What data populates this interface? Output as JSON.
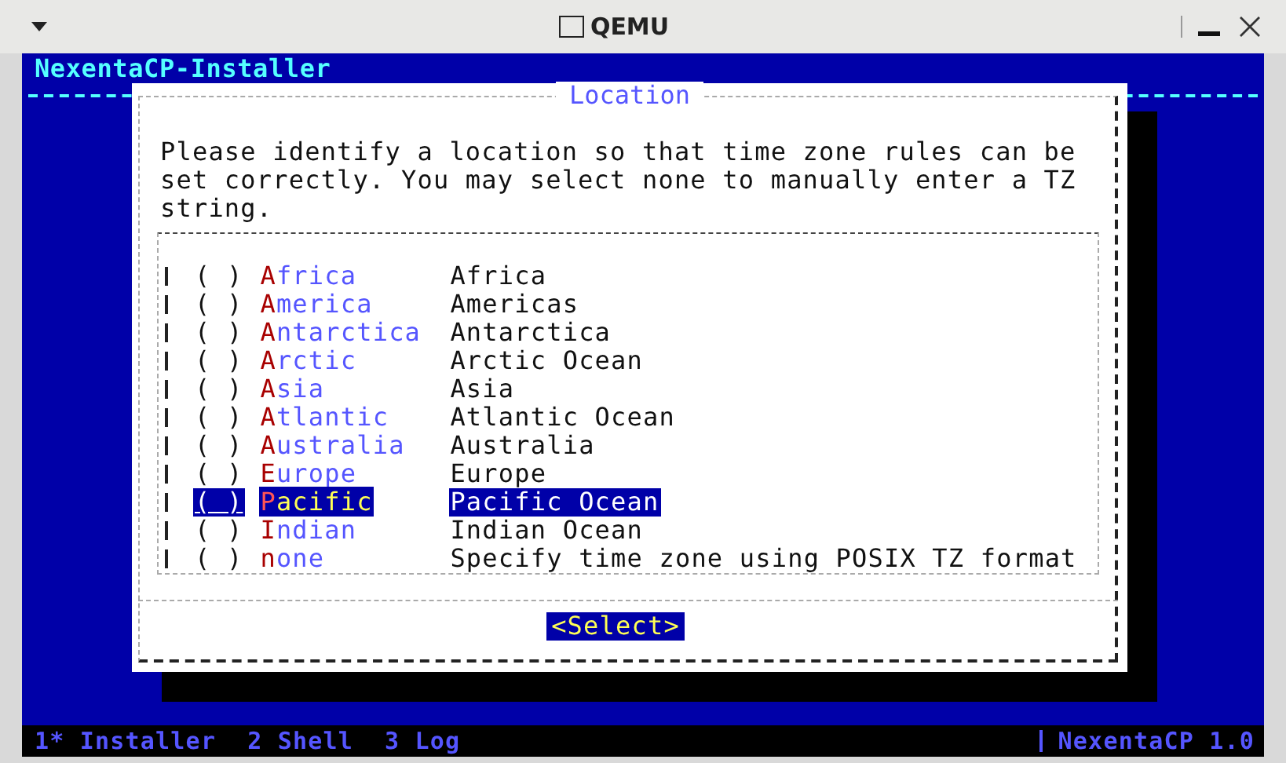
{
  "window": {
    "title": "QEMU"
  },
  "console": {
    "title": "NexentaCP-Installer"
  },
  "dialog": {
    "title": "Location",
    "message": "Please identify a location so that time zone rules can be set correctly.  You may select none to manually enter a TZ string.",
    "items": [
      {
        "name": "Africa",
        "description": "Africa",
        "selected": false
      },
      {
        "name": "America",
        "description": "Americas",
        "selected": false
      },
      {
        "name": "Antarctica",
        "description": "Antarctica",
        "selected": false
      },
      {
        "name": "Arctic",
        "description": "Arctic Ocean",
        "selected": false
      },
      {
        "name": "Asia",
        "description": "Asia",
        "selected": false
      },
      {
        "name": "Atlantic",
        "description": "Atlantic Ocean",
        "selected": false
      },
      {
        "name": "Australia",
        "description": "Australia",
        "selected": false
      },
      {
        "name": "Europe",
        "description": "Europe",
        "selected": false
      },
      {
        "name": "Pacific",
        "description": "Pacific Ocean",
        "selected": true
      },
      {
        "name": "Indian",
        "description": "Indian Ocean",
        "selected": false
      },
      {
        "name": "none",
        "description": "Specify time zone using POSIX TZ format",
        "selected": false
      }
    ],
    "radio_mark": "( )",
    "button": "<Select>"
  },
  "status_bar": {
    "tabs": [
      "1* Installer",
      "2 Shell",
      "3 Log"
    ],
    "product": "NexentaCP 1.0"
  }
}
